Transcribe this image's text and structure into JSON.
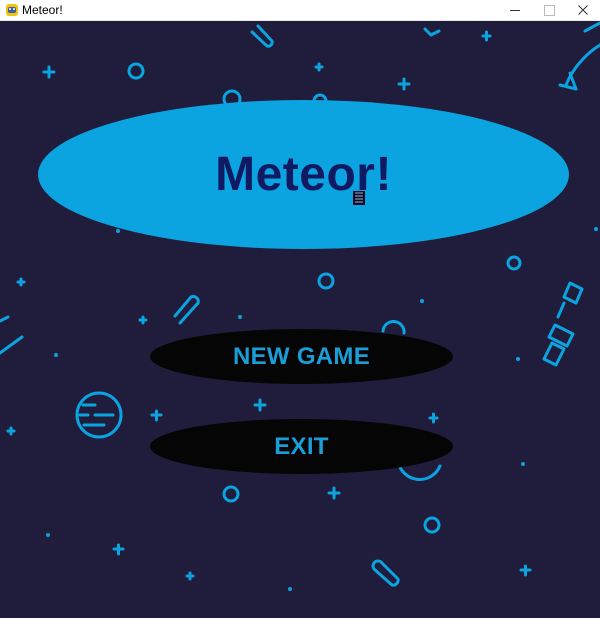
{
  "window": {
    "title": "Meteor!",
    "app_icon": "pygame-snake-icon",
    "controls": {
      "minimize_icon": "minimize-icon",
      "maximize_icon": "maximize-icon",
      "close_icon": "close-icon"
    }
  },
  "game": {
    "background_color": "#201c3c",
    "decoration_color": "#0ba3e0",
    "title": {
      "text": "Meteor!",
      "banner_color": "#0ba3e0",
      "text_color": "#101a63"
    },
    "menu": {
      "button_color": "#050505",
      "text_color": "#1a9ed8",
      "items": [
        {
          "label": "NEW GAME"
        },
        {
          "label": "EXIT"
        }
      ]
    },
    "decorations": [
      "plus-icon",
      "ring-icon",
      "comet-icon",
      "planet-icon",
      "satellite-icon",
      "rocket-icon",
      "dot-icon"
    ]
  }
}
